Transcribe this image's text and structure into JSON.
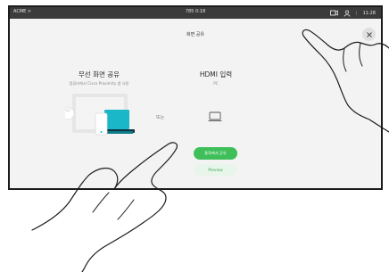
{
  "status_bar": {
    "left_label": "ACME >",
    "center_label": "785 0:18",
    "time": "11:28"
  },
  "dialog": {
    "title": "화면 공유",
    "wireless": {
      "title": "무선 화면 공유",
      "subtitle": "컴퓨터에서 Cisco Proximity 앱 사용"
    },
    "hdmi": {
      "title": "HDMI 입력",
      "subtitle": "PC"
    },
    "or_label": "또는",
    "share_button": "통화에서 공유",
    "preview_button": "Preview"
  },
  "colors": {
    "primary_green": "#3fbf5a",
    "status_bar": "#3b3b3b",
    "device_cyan": "#1ab7c9"
  },
  "icons": {
    "camera": "camera-icon",
    "person": "person-icon",
    "close": "close-icon",
    "laptop": "laptop-icon"
  }
}
